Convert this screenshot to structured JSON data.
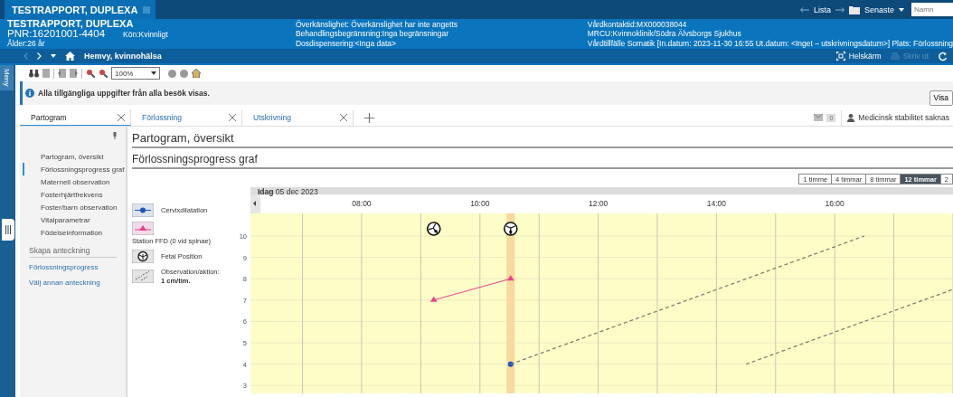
{
  "app_tab": {
    "title": "TESTRAPPORT, DUPLEXA"
  },
  "top_right": {
    "list_label": "Lista",
    "recent_label": "Senaste",
    "search": {
      "placeholder": "Namn"
    }
  },
  "patient": {
    "name": "TESTRAPPORT, DUPLEXA",
    "pnr": "PNR:16201001-4404",
    "gender": "Kön:Kvinnligt",
    "age": "Ålder:26 år"
  },
  "alerts": [
    "Överkänslighet: Överkänslighet har inte angetts",
    "Behandlingsbegränsning:Inga begränsningar",
    "Dosdispensering:<Inga data>"
  ],
  "care": [
    "Vårdkontaktid:MX000038044",
    "MRCU:Kvinnoklinik/Södra Älvsborgs Sjukhus",
    "Vårdtillfälle Somatik [In.datum: 2023-11-30 16:55 Ut.datum: <Inget – utskrivningsdatum>] Plats: Förlossning"
  ],
  "nav": {
    "location": "Hemvy, kvinnohälsa",
    "fullscreen": "Helskärm",
    "print": {
      "label": "Skriv ut",
      "disabled": true
    }
  },
  "side_menu_label": "Meny",
  "toolbar": {
    "zoom": "100%"
  },
  "info_banner": {
    "text": "Alla tillgängliga uppgifter från alla besök visas.",
    "button": "Visa"
  },
  "tabs": [
    {
      "label": "Partogram",
      "selected": true
    },
    {
      "label": "Förlossning",
      "selected": false
    },
    {
      "label": "Utskrivning",
      "selected": false
    }
  ],
  "status": {
    "badge": "0",
    "text": "Medicinsk stabilitet saknas"
  },
  "sidebar": {
    "items": [
      {
        "label": "Partogram, översikt",
        "selected": false
      },
      {
        "label": "Förlossningsprogress graf",
        "selected": true
      },
      {
        "label": "Maternell observation",
        "selected": false
      },
      {
        "label": "Fosterhjärtfrekvens",
        "selected": false
      },
      {
        "label": "Foster/barn observation",
        "selected": false
      },
      {
        "label": "Vitalparametrar",
        "selected": false
      },
      {
        "label": "Födelseinformation",
        "selected": false
      }
    ],
    "section": "Skapa anteckning",
    "links": [
      "Förlossningsprogress",
      "Välj annan anteckning"
    ]
  },
  "headings": [
    "Partogram, översikt",
    "Förlossningsprogress graf"
  ],
  "ranges": [
    {
      "label": "1 timme",
      "selected": false
    },
    {
      "label": "4 timmar",
      "selected": false
    },
    {
      "label": "8 timmar",
      "selected": false
    },
    {
      "label": "12 timmar",
      "selected": true
    },
    {
      "label": "2",
      "selected": false
    }
  ],
  "legend": [
    {
      "kind": "dilation"
    },
    {
      "kind": "station"
    },
    {
      "kind": "position",
      "label": "Fetal Position"
    },
    {
      "kind": "lines",
      "label": "Observation/aktion:",
      "value": "1 cm/tim."
    }
  ],
  "chart": {
    "today_label": "Idag",
    "date": "05 dec 2023",
    "fetal_heads": [
      true,
      true
    ],
    "chart_data": {
      "type": "line",
      "x": [
        9.22,
        10.52,
        14.5,
        16.5,
        18
      ],
      "series": [
        {
          "name": "Cervixdilatation",
          "color": "#1a56c8",
          "marker": "circle",
          "values": [
            null,
            4,
            null,
            null,
            null
          ]
        },
        {
          "name": "Station FFD (0 vid spinae)",
          "color": "#e8418a",
          "marker": "triangle",
          "values": [
            7,
            8,
            null,
            null,
            null
          ]
        },
        {
          "color": "#777766",
          "line_style": "dashed",
          "values": [
            null,
            4,
            null,
            10,
            null
          ]
        },
        {
          "color": "#777766",
          "line_style": "dashed",
          "values": [
            null,
            null,
            4,
            null,
            7.5
          ]
        }
      ],
      "xlim": [
        6.12,
        18
      ],
      "ylim": [
        2.63,
        11.06
      ],
      "grid": true,
      "bands": [
        {
          "axis": "x",
          "from": 10.45,
          "to": 10.59,
          "color": "#f8d9a0"
        }
      ],
      "xticks": [
        {
          "value": 8,
          "label": "08:00"
        },
        {
          "value": 10,
          "label": "10:00"
        },
        {
          "value": 12,
          "label": "12:00"
        },
        {
          "value": 14,
          "label": "14:00"
        },
        {
          "value": 16,
          "label": "16:00"
        }
      ],
      "yticks": [
        3,
        4,
        5,
        6,
        7,
        8,
        9,
        10
      ]
    }
  }
}
